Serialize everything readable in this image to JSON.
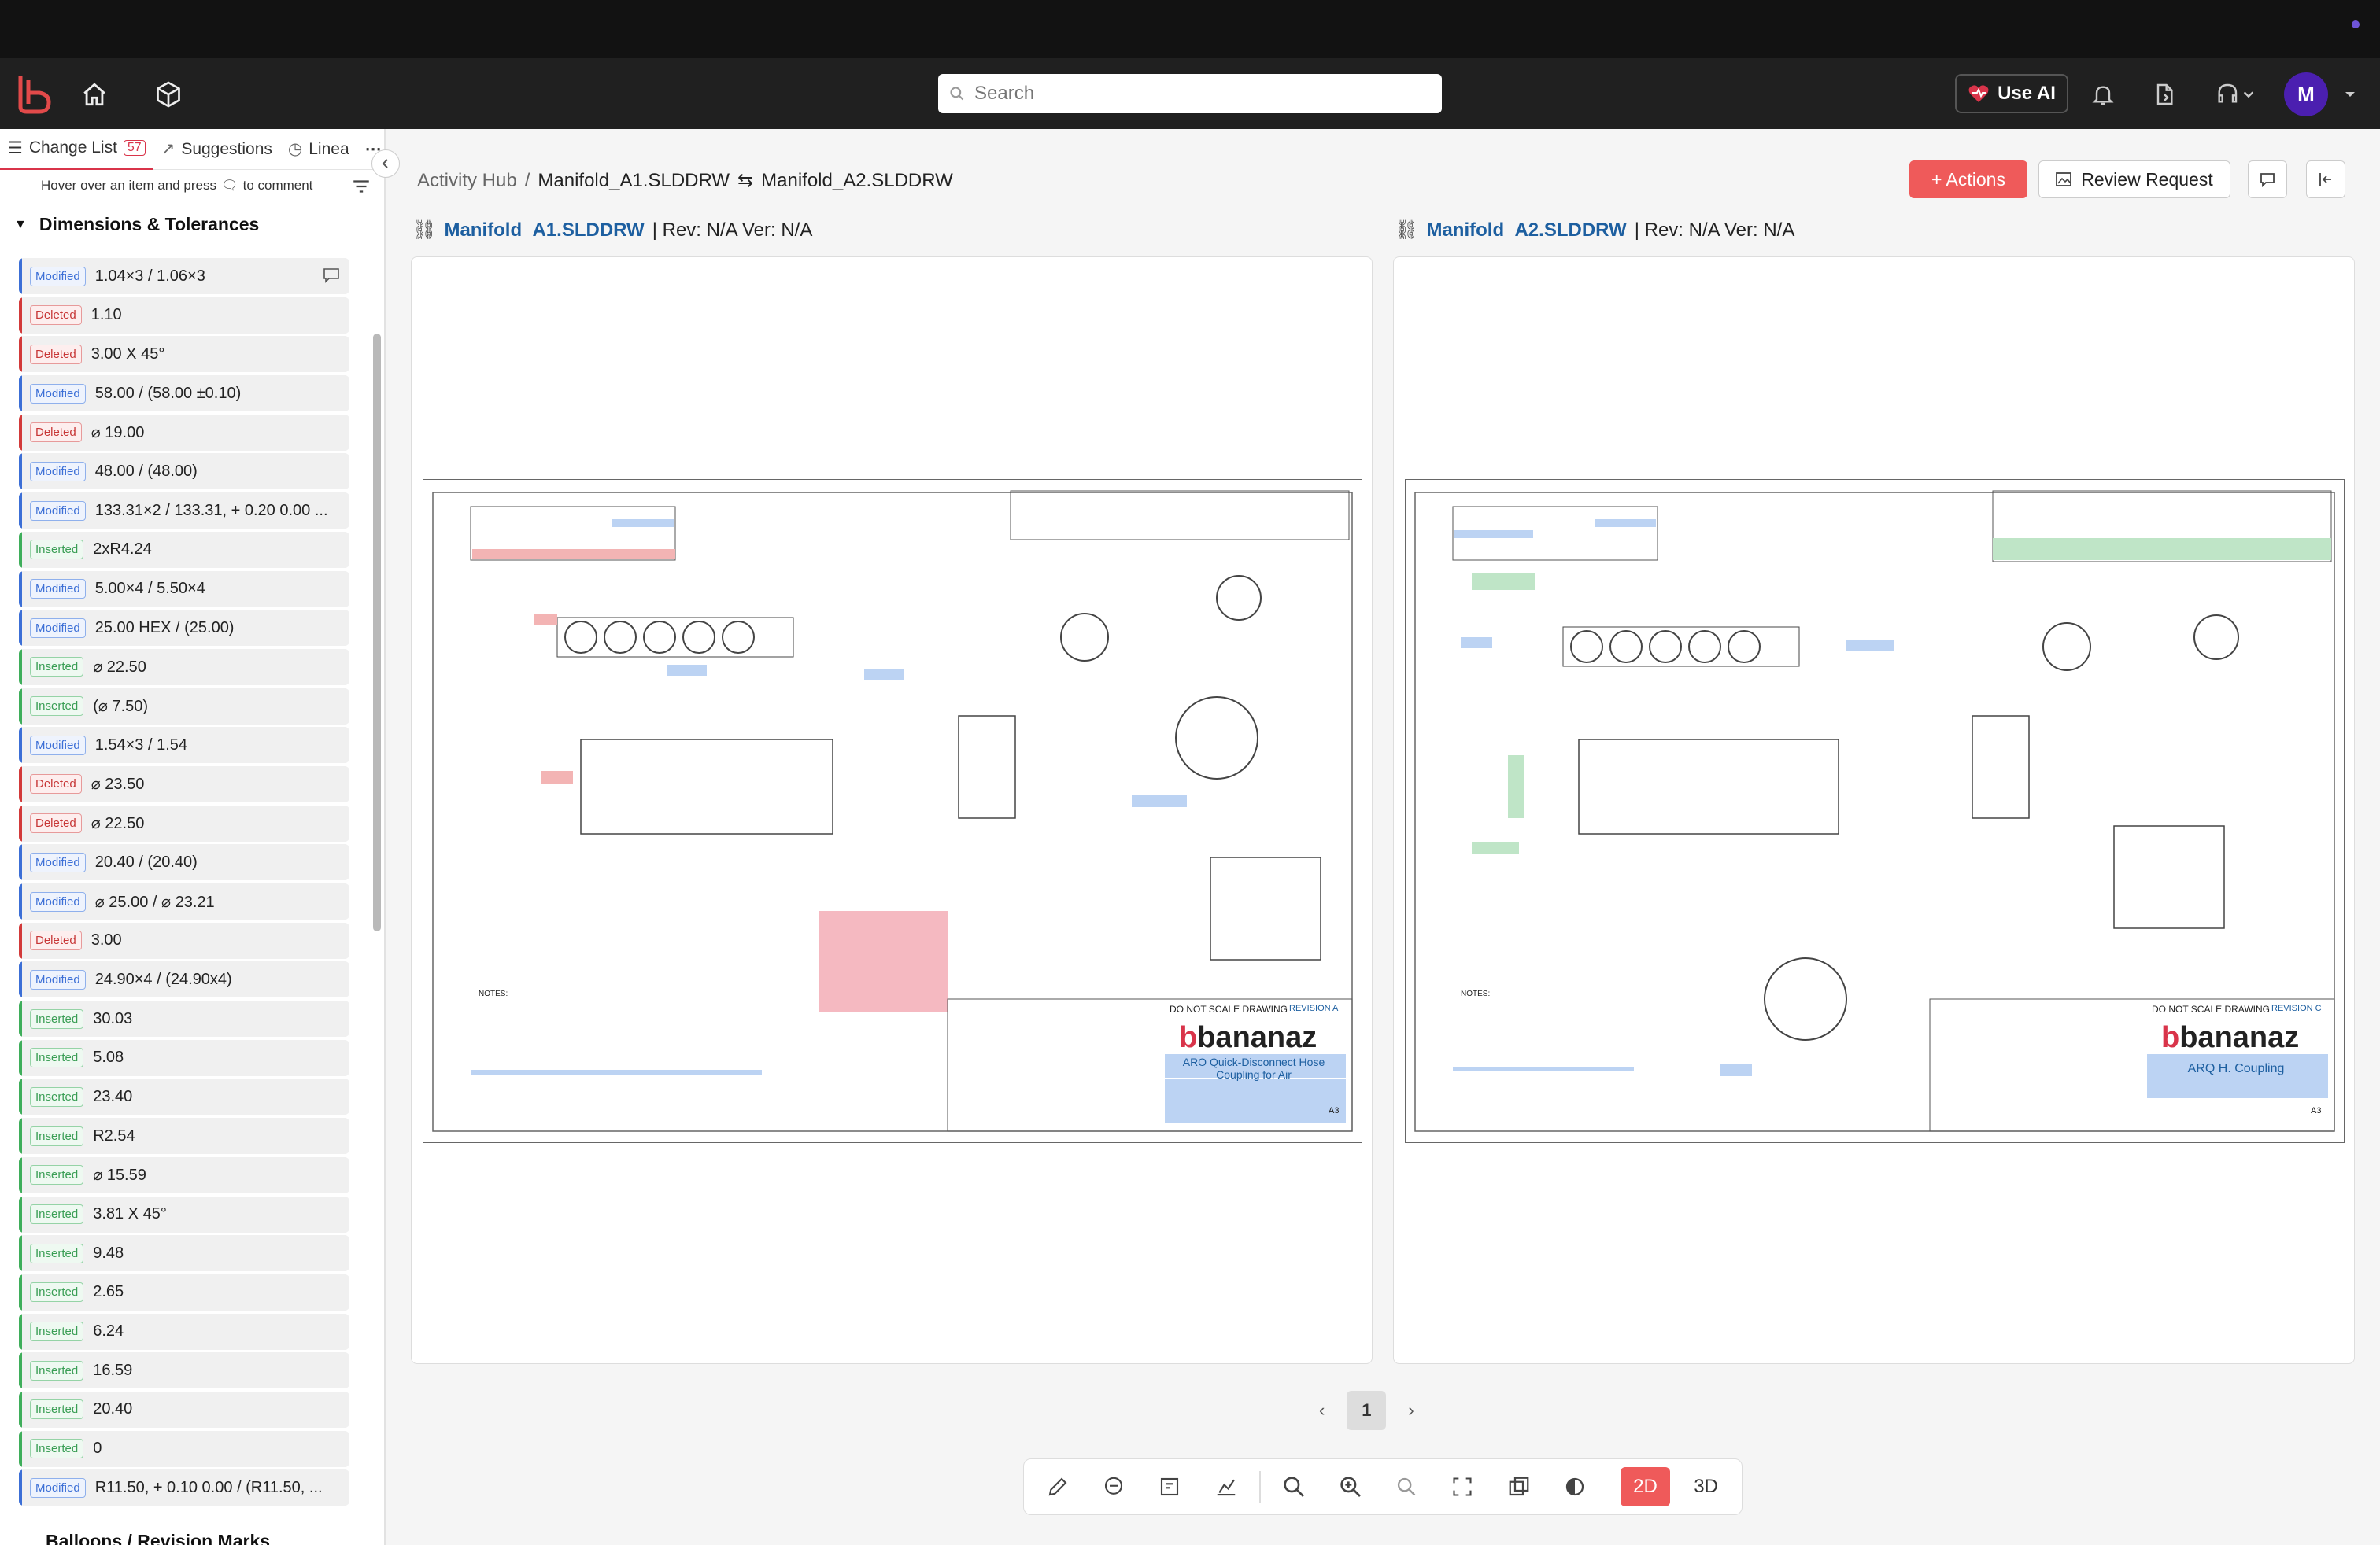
{
  "appbar": {
    "search_placeholder": "Search",
    "use_ai_label": "Use AI",
    "avatar_initial": "M"
  },
  "sidebar": {
    "tabs": [
      {
        "label": "Change List",
        "count": "57"
      },
      {
        "label": "Suggestions"
      },
      {
        "label": "Linea"
      }
    ],
    "hint_before": "Hover over an item and press",
    "hint_after": "to comment",
    "section_title": "Dimensions & Tolerances",
    "next_section_title": "Balloons / Revision Marks",
    "items": [
      {
        "status": "Modified",
        "text": "1.04×3 / 1.06×3"
      },
      {
        "status": "Deleted",
        "text": "1.10"
      },
      {
        "status": "Deleted",
        "text": "3.00 X 45°"
      },
      {
        "status": "Modified",
        "text": "58.00 /  (58.00 ±0.10)"
      },
      {
        "status": "Deleted",
        "text": "⌀ 19.00"
      },
      {
        "status": "Modified",
        "text": "48.00 /  (48.00)"
      },
      {
        "status": "Modified",
        "text": "133.31×2 / 133.31, + 0.20 0.00 ..."
      },
      {
        "status": "Inserted",
        "text": "2xR4.24"
      },
      {
        "status": "Modified",
        "text": "5.00×4 / 5.50×4"
      },
      {
        "status": "Modified",
        "text": "25.00 HEX /  (25.00)"
      },
      {
        "status": "Inserted",
        "text": "⌀ 22.50"
      },
      {
        "status": "Inserted",
        "text": "(⌀ 7.50)"
      },
      {
        "status": "Modified",
        "text": "1.54×3 / 1.54"
      },
      {
        "status": "Deleted",
        "text": "⌀ 23.50"
      },
      {
        "status": "Deleted",
        "text": "⌀ 22.50"
      },
      {
        "status": "Modified",
        "text": "20.40 /  (20.40)"
      },
      {
        "status": "Modified",
        "text": "⌀ 25.00 / ⌀ 23.21"
      },
      {
        "status": "Deleted",
        "text": "3.00"
      },
      {
        "status": "Modified",
        "text": "24.90×4 /  (24.90x4)"
      },
      {
        "status": "Inserted",
        "text": "30.03"
      },
      {
        "status": "Inserted",
        "text": "5.08"
      },
      {
        "status": "Inserted",
        "text": "23.40"
      },
      {
        "status": "Inserted",
        "text": "R2.54"
      },
      {
        "status": "Inserted",
        "text": "⌀ 15.59"
      },
      {
        "status": "Inserted",
        "text": "3.81 X 45°"
      },
      {
        "status": "Inserted",
        "text": "9.48"
      },
      {
        "status": "Inserted",
        "text": "2.65"
      },
      {
        "status": "Inserted",
        "text": "6.24"
      },
      {
        "status": "Inserted",
        "text": "16.59"
      },
      {
        "status": "Inserted",
        "text": "20.40"
      },
      {
        "status": "Inserted",
        "text": "0"
      },
      {
        "status": "Modified",
        "text": "R11.50, + 0.10 0.00 /  (R11.50, ..."
      }
    ]
  },
  "main": {
    "breadcrumb": {
      "root": "Activity Hub",
      "separator": "/",
      "left_file": "Manifold_A1.SLDDRW",
      "arrow": "⇆",
      "right_file": "Manifold_A2.SLDDRW"
    },
    "actions_label": "+ Actions",
    "review_label": "Review Request",
    "left_doc": {
      "name": "Manifold_A1.SLDDRW",
      "meta": "| Rev: N/A   Ver: N/A"
    },
    "right_doc": {
      "name": "Manifold_A2.SLDDRW",
      "meta": "| Rev: N/A   Ver: N/A"
    },
    "left_sheet": {
      "brand": "bananaz",
      "title": "ARO Quick-Disconnect Hose Coupling for Air",
      "sheet_size": "A3",
      "note": "DO NOT SCALE DRAWING",
      "revision": "REVISION  A",
      "notes_title": "NOTES:"
    },
    "right_sheet": {
      "brand": "bananaz",
      "title": "ARQ H. Coupling",
      "sheet_size": "A3",
      "note": "DO NOT SCALE DRAWING",
      "revision": "REVISION  C",
      "notes_title": "NOTES:"
    },
    "page": "1"
  },
  "toolbar": {
    "mode_2d": "2D",
    "mode_3d": "3D"
  },
  "colors": {
    "accent": "#ef5a5a",
    "modified": "#3c6fd6",
    "deleted": "#d23a3a",
    "inserted": "#3fae5b",
    "link": "#1d5fa0"
  }
}
